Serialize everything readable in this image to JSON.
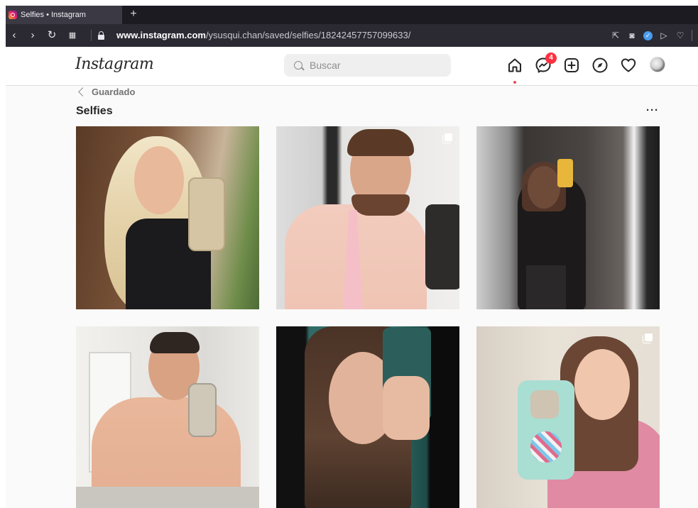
{
  "browser": {
    "tab_title": "Selfies • Instagram",
    "new_tab_label": "+",
    "url_host": "www.instagram.com",
    "url_path": "/ysusqui.chan/saved/selfies/18242457757099633/"
  },
  "header": {
    "logo_text": "Instagram",
    "search_placeholder": "Buscar",
    "messages_badge": "4"
  },
  "page": {
    "back_label": "Guardado",
    "title": "Selfies",
    "more_label": "···"
  },
  "colors": {
    "accent_red": "#ff3040",
    "text_primary": "#262626",
    "text_secondary": "#8e8e8e"
  },
  "icons": [
    "instagram-favicon-icon",
    "back-arrow-icon",
    "forward-arrow-icon",
    "reload-icon",
    "grid-apps-icon",
    "lock-icon",
    "share-icon",
    "camera-icon",
    "shield-icon",
    "send-icon",
    "heart-outline-icon",
    "search-icon",
    "home-icon",
    "messenger-icon",
    "new-post-icon",
    "explore-icon",
    "activity-heart-icon",
    "chevron-left-icon",
    "more-icon",
    "multiple-posts-icon"
  ]
}
